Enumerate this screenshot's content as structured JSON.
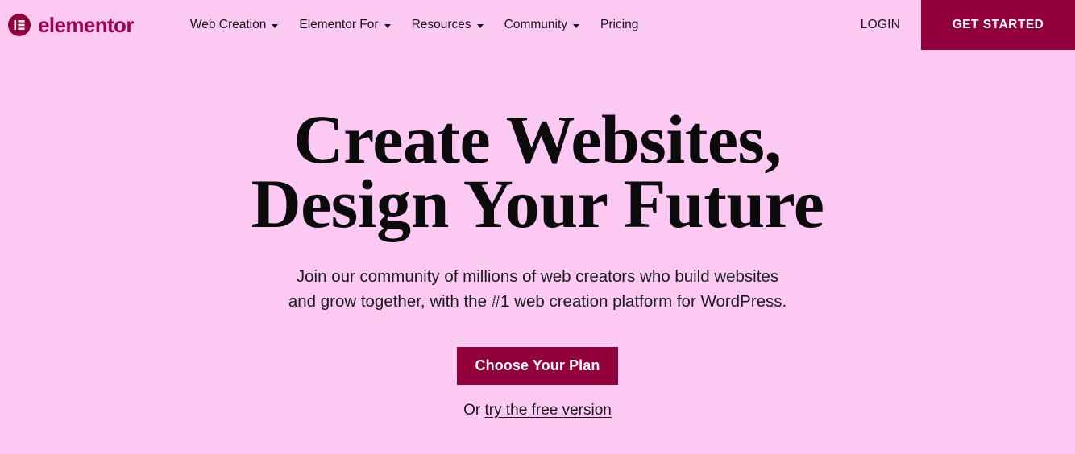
{
  "theme": {
    "background": "#fbc9f2",
    "accent": "#92003b",
    "logo_color": "#a3004a",
    "text": "#17161a",
    "heading_color": "#0b0b0b",
    "button_text": "#ffffff"
  },
  "header": {
    "brand": {
      "name": "elementor",
      "icon": "elementor-logo-icon"
    },
    "nav": [
      {
        "label": "Web Creation",
        "has_dropdown": true
      },
      {
        "label": "Elementor For",
        "has_dropdown": true
      },
      {
        "label": "Resources",
        "has_dropdown": true
      },
      {
        "label": "Community",
        "has_dropdown": true
      },
      {
        "label": "Pricing",
        "has_dropdown": false
      }
    ],
    "login_label": "LOGIN",
    "get_started_label": "GET STARTED"
  },
  "hero": {
    "title_line1": "Create Websites,",
    "title_line2": "Design Your Future",
    "subtitle_line1": "Join our community of millions of web creators who build websites",
    "subtitle_line2": "and grow together, with the #1 web creation platform for WordPress.",
    "cta_label": "Choose Your Plan",
    "secondary_prefix": "Or ",
    "secondary_link": "try the free version"
  }
}
